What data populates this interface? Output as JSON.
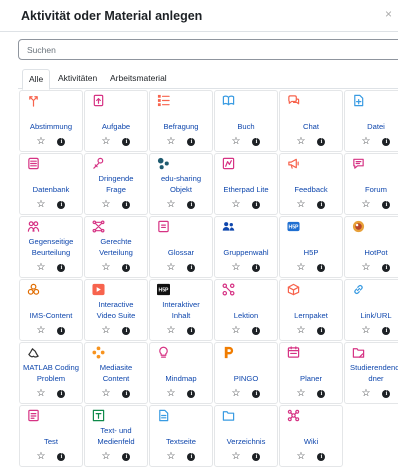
{
  "dialog": {
    "title": "Aktivität oder Material anlegen",
    "close": "×"
  },
  "search": {
    "placeholder": "Suchen"
  },
  "tabs": [
    {
      "label": "Alle",
      "active": true
    },
    {
      "label": "Aktivitäten",
      "active": false
    },
    {
      "label": "Arbeitsmaterial",
      "active": false
    }
  ],
  "items": [
    {
      "label": "Abstimmung",
      "icon": "fork-choice-icon",
      "color": "#f7634d"
    },
    {
      "label": "Aufgabe",
      "icon": "assignment-upload-icon",
      "color": "#d63384"
    },
    {
      "label": "Befragung",
      "icon": "survey-list-icon",
      "color": "#f7634d"
    },
    {
      "label": "Buch",
      "icon": "book-icon",
      "color": "#399be2"
    },
    {
      "label": "Chat",
      "icon": "chat-icon",
      "color": "#f7634d"
    },
    {
      "label": "Datei",
      "icon": "file-icon",
      "color": "#399be2"
    },
    {
      "label": "Datenbank",
      "icon": "database-icon",
      "color": "#d63384"
    },
    {
      "label": "Dringende\nFrage",
      "icon": "urgent-question-icon",
      "color": "#d63384"
    },
    {
      "label": "edu-sharing\nObjekt",
      "icon": "edu-sharing-icon",
      "color": "#1f5b70"
    },
    {
      "label": "Etherpad Lite",
      "icon": "etherpad-icon",
      "color": "#d63384"
    },
    {
      "label": "Feedback",
      "icon": "megaphone-icon",
      "color": "#f7634d"
    },
    {
      "label": "Forum",
      "icon": "forum-icon",
      "color": "#d63384"
    },
    {
      "label": "Gegenseitige\nBeurteilung",
      "icon": "peer-assessment-icon",
      "color": "#d63384"
    },
    {
      "label": "Gerechte\nVerteilung",
      "icon": "fair-allocation-icon",
      "color": "#d63384"
    },
    {
      "label": "Glossar",
      "icon": "glossary-icon",
      "color": "#d63384"
    },
    {
      "label": "Gruppenwahl",
      "icon": "group-choice-icon",
      "color": "#0f47ad"
    },
    {
      "label": "H5P",
      "icon": "h5p-icon",
      "color": "#1f6fd1"
    },
    {
      "label": "HotPot",
      "icon": "hotpot-icon",
      "color": "#c0392b"
    },
    {
      "label": "IMS-Content",
      "icon": "ims-content-icon",
      "color": "#e06c00"
    },
    {
      "label": "Interactive\nVideo Suite",
      "icon": "video-suite-icon",
      "color": "#f7634d"
    },
    {
      "label": "Interaktiver\nInhalt",
      "icon": "h5p-dark-icon",
      "color": "#111111"
    },
    {
      "label": "Lektion",
      "icon": "lesson-icon",
      "color": "#d63384"
    },
    {
      "label": "Lernpaket",
      "icon": "package-icon",
      "color": "#f7634d"
    },
    {
      "label": "Link/URL",
      "icon": "link-icon",
      "color": "#399be2"
    },
    {
      "label": "MATLAB Coding\nProblem",
      "icon": "matlab-icon",
      "color": "#333333"
    },
    {
      "label": "Mediasite\nContent",
      "icon": "mediasite-icon",
      "color": "#f7931e"
    },
    {
      "label": "Mindmap",
      "icon": "lightbulb-icon",
      "color": "#d63384"
    },
    {
      "label": "PINGO",
      "icon": "pingo-icon",
      "color": "#f07c00"
    },
    {
      "label": "Planer",
      "icon": "planner-icon",
      "color": "#d63384"
    },
    {
      "label": "Studierendenor\ndner",
      "icon": "student-folder-icon",
      "color": "#d63384"
    },
    {
      "label": "Test",
      "icon": "quiz-icon",
      "color": "#d63384"
    },
    {
      "label": "Text- und\nMedienfeld",
      "icon": "text-media-icon",
      "color": "#0f8a4a"
    },
    {
      "label": "Textseite",
      "icon": "page-icon",
      "color": "#399be2"
    },
    {
      "label": "Verzeichnis",
      "icon": "folder-icon",
      "color": "#399be2"
    },
    {
      "label": "Wiki",
      "icon": "wiki-icon",
      "color": "#d63384"
    }
  ]
}
